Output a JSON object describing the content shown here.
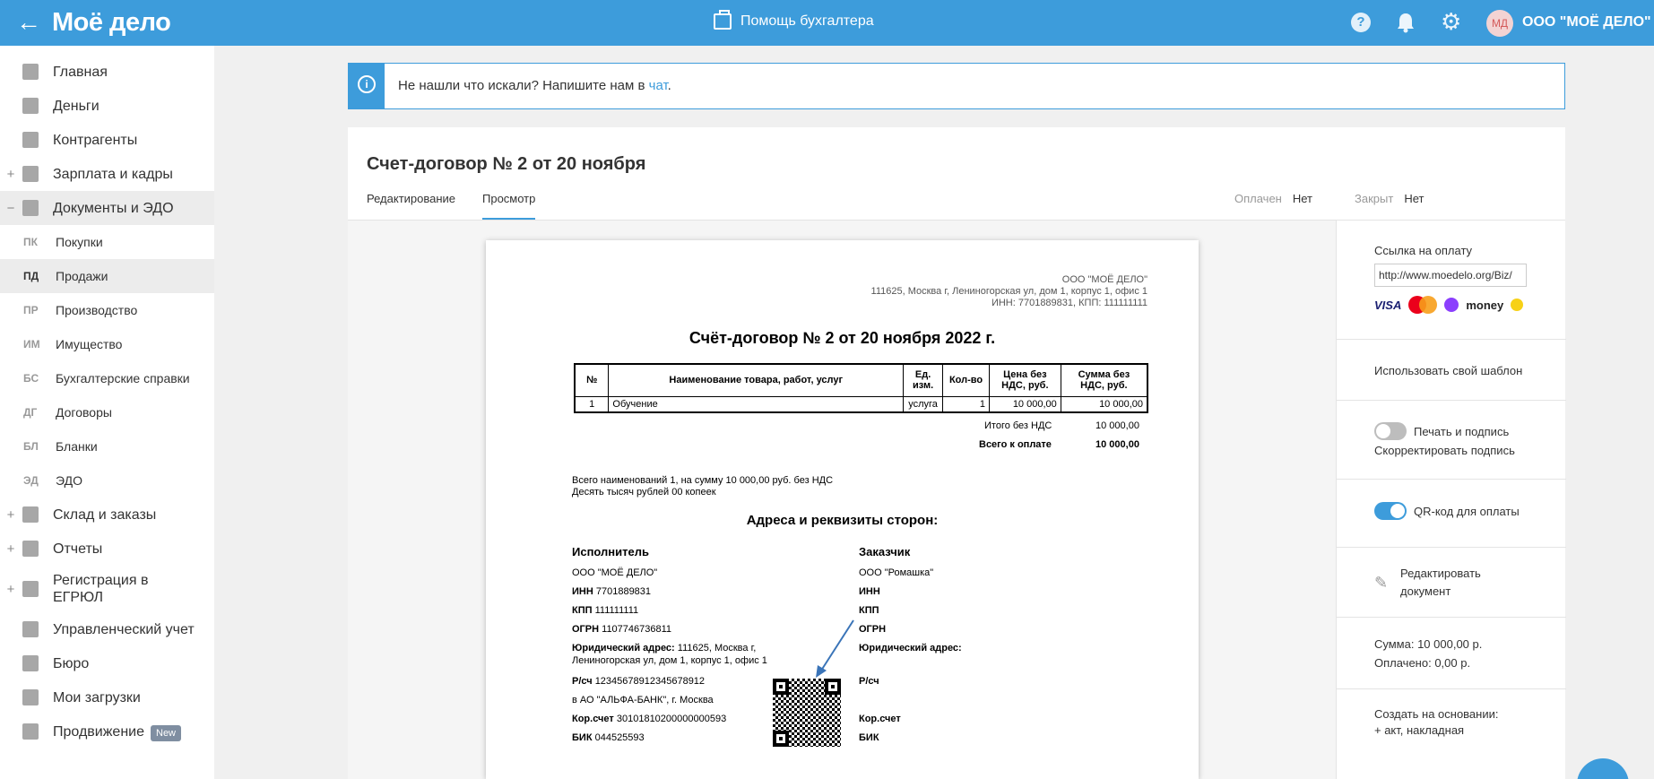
{
  "topbar": {
    "back_glyph": "←",
    "logo": "Моё дело",
    "help_label": "Помощь бухгалтера",
    "question_glyph": "?",
    "gear_glyph": "⚙",
    "avatar_initials": "МД",
    "company": "ООО \"МОЁ ДЕЛО\"",
    "icons": [
      "back-arrow-icon",
      "briefcase-icon",
      "question-icon",
      "bell-icon",
      "gear-icon"
    ]
  },
  "sidebar": {
    "items": [
      {
        "label": "Главная",
        "icon": "home-icon",
        "plus": ""
      },
      {
        "label": "Деньги",
        "icon": "money-icon",
        "plus": ""
      },
      {
        "label": "Контрагенты",
        "icon": "contacts-icon",
        "plus": ""
      },
      {
        "label": "Зарплата и кадры",
        "icon": "salary-icon",
        "plus": "+"
      },
      {
        "label": "Документы и ЭДО",
        "icon": "folder-icon",
        "plus": "−"
      },
      {
        "label": "Склад и заказы",
        "icon": "warehouse-icon",
        "plus": "+"
      },
      {
        "label": "Отчеты",
        "icon": "reports-icon",
        "plus": "+"
      },
      {
        "label": "Регистрация в ЕГРЮЛ",
        "icon": "registration-icon",
        "plus": "+"
      },
      {
        "label": "Управленческий учет",
        "icon": "management-icon",
        "plus": ""
      },
      {
        "label": "Бюро",
        "icon": "briefcase-icon",
        "plus": ""
      },
      {
        "label": "Мои загрузки",
        "icon": "download-icon",
        "plus": ""
      },
      {
        "label": "Продвижение",
        "icon": "promotion-icon",
        "plus": "",
        "badge": "New"
      }
    ],
    "subitems": [
      {
        "abbr": "ПК",
        "label": "Покупки"
      },
      {
        "abbr": "ПД",
        "label": "Продажи"
      },
      {
        "abbr": "ПР",
        "label": "Производство"
      },
      {
        "abbr": "ИМ",
        "label": "Имущество"
      },
      {
        "abbr": "БС",
        "label": "Бухгалтерские справки"
      },
      {
        "abbr": "ДГ",
        "label": "Договоры"
      },
      {
        "abbr": "БЛ",
        "label": "Бланки"
      },
      {
        "abbr": "ЭД",
        "label": "ЭДО"
      }
    ]
  },
  "banner": {
    "icon_glyph": "i",
    "text": "Не нашли что искали? Напишите нам в ",
    "link": "чат",
    "suffix": "."
  },
  "document": {
    "title": "Счет-договор № 2 от 20 ноября",
    "tabs": [
      "Редактирование",
      "Просмотр"
    ],
    "active_tab": "Просмотр",
    "paid_label": "Оплачен",
    "paid_value": "Нет",
    "closed_label": "Закрыт",
    "closed_value": "Нет"
  },
  "paper": {
    "header": {
      "company": "ООО \"МОЁ ДЕЛО\"",
      "address": "111625, Москва г, Лениногорская ул, дом 1, корпус 1, офис 1",
      "inn_kpp": "ИНН: 7701889831, КПП: 111111111"
    },
    "title": "Счёт-договор № 2 от 20 ноября 2022 г.",
    "table": {
      "headers": [
        "№",
        "Наименование товара, работ, услуг",
        "Ед. изм.",
        "Кол-во",
        "Цена без НДС, руб.",
        "Сумма без НДС, руб."
      ],
      "rows": [
        [
          "1",
          "Обучение",
          "услуга",
          "1",
          "10 000,00",
          "10 000,00"
        ]
      ]
    },
    "total_label": "Итого без НДС",
    "total_value": "10 000,00",
    "to_pay_label": "Всего к оплате",
    "to_pay_value": "10 000,00",
    "words_line1": "Всего наименований 1, на сумму 10 000,00 руб. без НДС",
    "words_line2": "Десять тысяч рублей 00 копеек",
    "addresses_title": "Адреса и реквизиты сторон:",
    "executor": {
      "heading": "Исполнитель",
      "name": "ООО \"МОЁ ДЕЛО\"",
      "inn_label": "ИНН",
      "inn": "7701889831",
      "kpp_label": "КПП",
      "kpp": "111111111",
      "ogrn_label": "ОГРН",
      "ogrn": "1107746736811",
      "address_label": "Юридический адрес:",
      "address_line1": "111625, Москва г,",
      "address_line2": "Лениногорская ул, дом 1, корпус 1, офис 1",
      "account_label": "Р/сч",
      "account": "12345678912345678912",
      "bank": "в АО \"АЛЬФА-БАНК\", г. Москва",
      "corr_label": "Кор.счет",
      "corr": "30101810200000000593",
      "bik_label": "БИК",
      "bik": "044525593"
    },
    "customer": {
      "heading": "Заказчик",
      "name": "ООО \"Ромашка\"",
      "inn_label": "ИНН",
      "kpp_label": "КПП",
      "ogrn_label": "ОГРН",
      "address_label": "Юридический адрес:",
      "account_label": "Р/сч",
      "corr_label": "Кор.счет",
      "bik_label": "БИК"
    }
  },
  "right_panel": {
    "payment_link_label": "Ссылка на оплату",
    "payment_link_value": "http://www.moedelo.org/Biz/",
    "pay_logos": [
      "VISA",
      "mastercard",
      "money"
    ],
    "use_template": "Использовать свой шаблон",
    "print_sign_label": "Печать и подпись",
    "print_sign_on": false,
    "correct_sign": "Скорректировать подпись",
    "qr_label": "QR-код для оплаты",
    "qr_on": true,
    "edit_line1": "Редактировать",
    "edit_line2": "документ",
    "sum_line": "Сумма: 10 000,00 р.",
    "paid_line": "Оплачено: 0,00 р.",
    "create_based": "Создать на основании:",
    "create_link": "+ акт, накладная"
  },
  "colors": {
    "accent": "#3d9cdb",
    "sidebar_active": "#ececec",
    "badge": "#7f8ea1"
  }
}
